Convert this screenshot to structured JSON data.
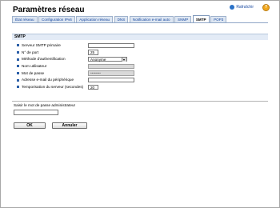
{
  "header": {
    "title": "Paramètres réseau",
    "refresh_label": "Rafraîchir",
    "help_glyph": "?"
  },
  "tabs": [
    {
      "label": "État réseau",
      "active": false
    },
    {
      "label": "Configuration IPv6",
      "active": false
    },
    {
      "label": "Application réseau",
      "active": false
    },
    {
      "label": "DNS",
      "active": false
    },
    {
      "label": "Notification e-mail auto",
      "active": false
    },
    {
      "label": "SNMP",
      "active": false
    },
    {
      "label": "SMTP",
      "active": true
    },
    {
      "label": "POP3",
      "active": false
    }
  ],
  "section": {
    "title": "SMTP"
  },
  "fields": {
    "server": {
      "label": "Serveur SMTP primaire",
      "value": ""
    },
    "port": {
      "label": "N° de port",
      "value": "25"
    },
    "auth": {
      "label": "Méthode d'authentification",
      "value": "Anonyme"
    },
    "user": {
      "label": "Nom utilisateur",
      "value": ""
    },
    "password": {
      "label": "Mot de passe",
      "value": "••••••••"
    },
    "email": {
      "label": "Adresse e-mail du périphérique",
      "value": ""
    },
    "timeout": {
      "label": "Temporisation du serveur (secondes)",
      "value": "20"
    }
  },
  "admin": {
    "label": "Saisir le mot de passe administrateur",
    "value": ""
  },
  "buttons": {
    "ok": "OK",
    "cancel": "Annuler"
  },
  "colors": {
    "tab_bg": "#dde6f2",
    "section_bg": "#e3ebf6",
    "bullet": "#2b5fa8",
    "link": "#1a4aa0"
  }
}
